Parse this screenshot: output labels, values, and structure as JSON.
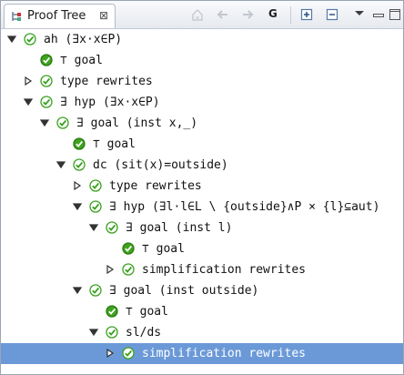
{
  "view": {
    "title": "Proof Tree",
    "close_glyph": "⊠"
  },
  "toolbar": {
    "buttons": [
      {
        "name": "home-icon",
        "enabled": false
      },
      {
        "name": "back-arrow-icon",
        "enabled": false
      },
      {
        "name": "forward-arrow-icon",
        "enabled": false
      },
      {
        "name": "go-into-label",
        "label": "G"
      },
      {
        "name": "expand-all-icon",
        "enabled": true
      },
      {
        "name": "collapse-all-icon",
        "enabled": true
      },
      {
        "name": "view-menu-icon",
        "enabled": true
      }
    ]
  },
  "colors": {
    "check_fill": "#3fa31e",
    "check_dark": "#2a7a12",
    "check_outline": "#39a11e",
    "selection": "#6b99d8"
  },
  "tree": [
    {
      "depth": 0,
      "twisty": "expanded",
      "check": "outline",
      "text": "ah (∃x·x∈P)"
    },
    {
      "depth": 1,
      "twisty": "none",
      "check": "filled",
      "text": "⊤ goal"
    },
    {
      "depth": 1,
      "twisty": "collapsed",
      "check": "outline",
      "text": "type rewrites"
    },
    {
      "depth": 1,
      "twisty": "expanded",
      "check": "outline",
      "text": "∃ hyp (∃x·x∈P)"
    },
    {
      "depth": 2,
      "twisty": "expanded",
      "check": "outline",
      "text": "∃ goal (inst x,_)"
    },
    {
      "depth": 3,
      "twisty": "none",
      "check": "filled",
      "text": "⊤ goal"
    },
    {
      "depth": 3,
      "twisty": "expanded",
      "check": "outline",
      "text": "dc (sit(x)=outside)"
    },
    {
      "depth": 4,
      "twisty": "collapsed",
      "check": "outline",
      "text": "type rewrites"
    },
    {
      "depth": 4,
      "twisty": "expanded",
      "check": "outline",
      "text": "∃ hyp (∃l·l∈L \\ {outside}∧P × {l}⊆aut)"
    },
    {
      "depth": 5,
      "twisty": "expanded",
      "check": "outline",
      "text": "∃ goal (inst l)"
    },
    {
      "depth": 6,
      "twisty": "none",
      "check": "filled",
      "text": "⊤ goal"
    },
    {
      "depth": 6,
      "twisty": "collapsed",
      "check": "outline",
      "text": "simplification rewrites"
    },
    {
      "depth": 4,
      "twisty": "expanded",
      "check": "outline",
      "text": "∃ goal (inst outside)"
    },
    {
      "depth": 5,
      "twisty": "none",
      "check": "filled",
      "text": "⊤ goal"
    },
    {
      "depth": 5,
      "twisty": "expanded",
      "check": "outline",
      "text": "sl/ds"
    },
    {
      "depth": 6,
      "twisty": "collapsed",
      "check": "outline",
      "text": "simplification rewrites",
      "selected": true
    }
  ]
}
